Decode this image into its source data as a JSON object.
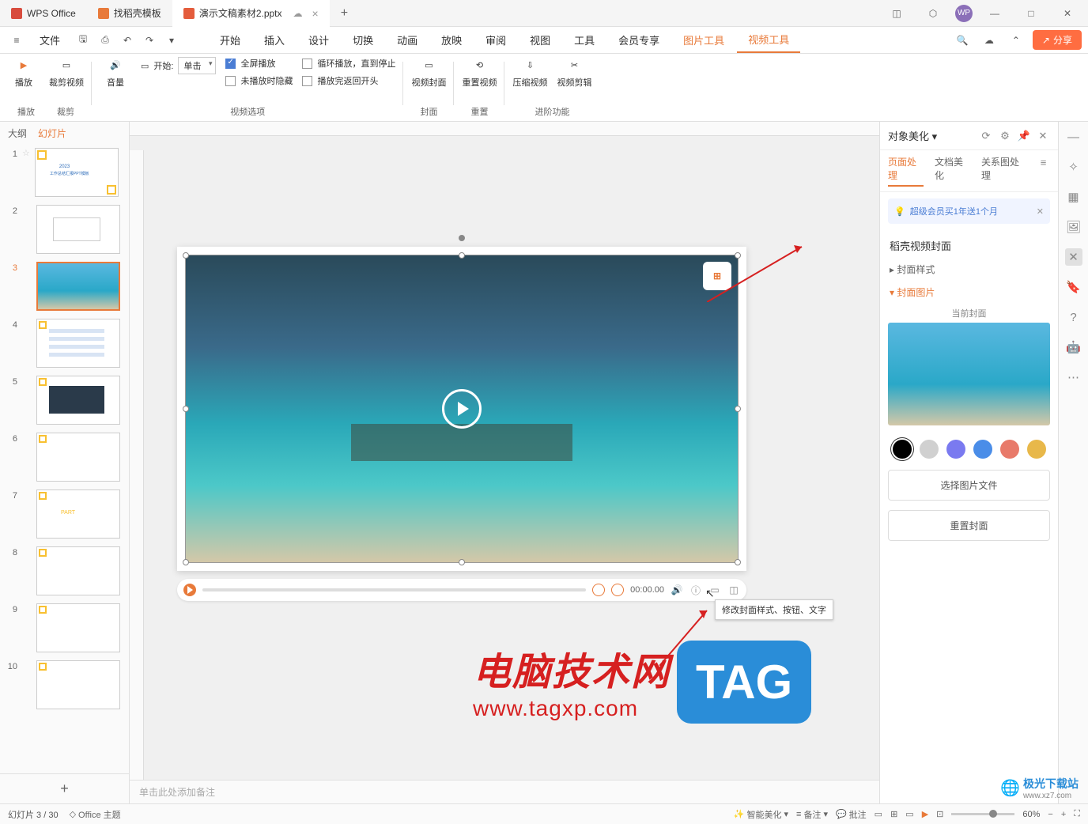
{
  "titlebar": {
    "tabs": [
      {
        "label": "WPS Office",
        "icon": "wps"
      },
      {
        "label": "找稻壳模板",
        "icon": "doc"
      },
      {
        "label": "演示文稿素材2.pptx",
        "icon": "ppt"
      }
    ],
    "avatar": "WP"
  },
  "menubar": {
    "file": "文件",
    "items": [
      "开始",
      "插入",
      "设计",
      "切换",
      "动画",
      "放映",
      "审阅",
      "视图",
      "工具",
      "会员专享"
    ],
    "orange_items": [
      "图片工具",
      "视频工具"
    ],
    "active": "视频工具",
    "share": "分享"
  },
  "ribbon": {
    "play": {
      "btn1": "播放",
      "btn2": "裁剪视频",
      "label": "播放",
      "label2": "裁剪"
    },
    "volume": {
      "btn": "音量",
      "start_label": "开始:",
      "dropdown": "单击",
      "cb_fullscreen": "全屏播放",
      "cb_loop": "循环播放，直到停止",
      "cb_hide": "未播放时隐藏",
      "cb_rewind": "播放完返回开头",
      "label": "视频选项"
    },
    "cover": {
      "btn": "视频封面",
      "label": "封面"
    },
    "reset": {
      "btn": "重置视频",
      "label": "重置"
    },
    "advanced": {
      "btn1": "压缩视频",
      "btn2": "视频剪辑",
      "label": "进阶功能"
    }
  },
  "left_panel": {
    "tabs": {
      "outline": "大纲",
      "slides": "幻灯片"
    }
  },
  "slides": [
    1,
    2,
    3,
    4,
    5,
    6,
    7,
    8,
    9,
    10
  ],
  "video": {
    "time": "00:00.00",
    "tooltip": "修改封面样式、按钮、文字"
  },
  "notes_placeholder": "单击此处添加备注",
  "right_panel": {
    "title": "对象美化",
    "tabs": {
      "page": "页面处理",
      "doc": "文档美化",
      "relation": "关系图处理"
    },
    "promo": "超级会员买1年送1个月",
    "section": "稻壳视频封面",
    "collapse1": "封面样式",
    "collapse2": "封面图片",
    "cover_label": "当前封面",
    "colors": [
      "#000000",
      "#d0d0d0",
      "#7a7af0",
      "#4a8de8",
      "#e87a6a",
      "#e8b84a"
    ],
    "btn_select": "选择图片文件",
    "btn_reset": "重置封面"
  },
  "statusbar": {
    "slide_info": "幻灯片 3 / 30",
    "theme": "Office 主题",
    "smart": "智能美化",
    "notes": "备注",
    "comments": "批注",
    "zoom": "60%"
  },
  "watermark": {
    "line1": "电脑技术网",
    "line2": "www.tagxp.com",
    "tag": "TAG",
    "site": "极光下载站",
    "url": "www.xz7.com"
  }
}
